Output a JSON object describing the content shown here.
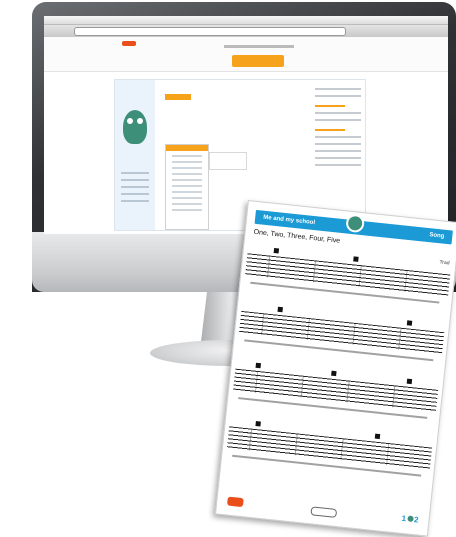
{
  "sheet": {
    "header_left": "Me and my school",
    "header_right": "Song",
    "song_title": "One, Two, Three, Four, Five",
    "credit": "Trad",
    "page_first": "1",
    "page_second": "2"
  },
  "colors": {
    "accent_blue": "#1b9ad6",
    "accent_orange": "#f7a21b",
    "brand_red": "#e94e1b",
    "robot_green": "#3e8f7a"
  }
}
